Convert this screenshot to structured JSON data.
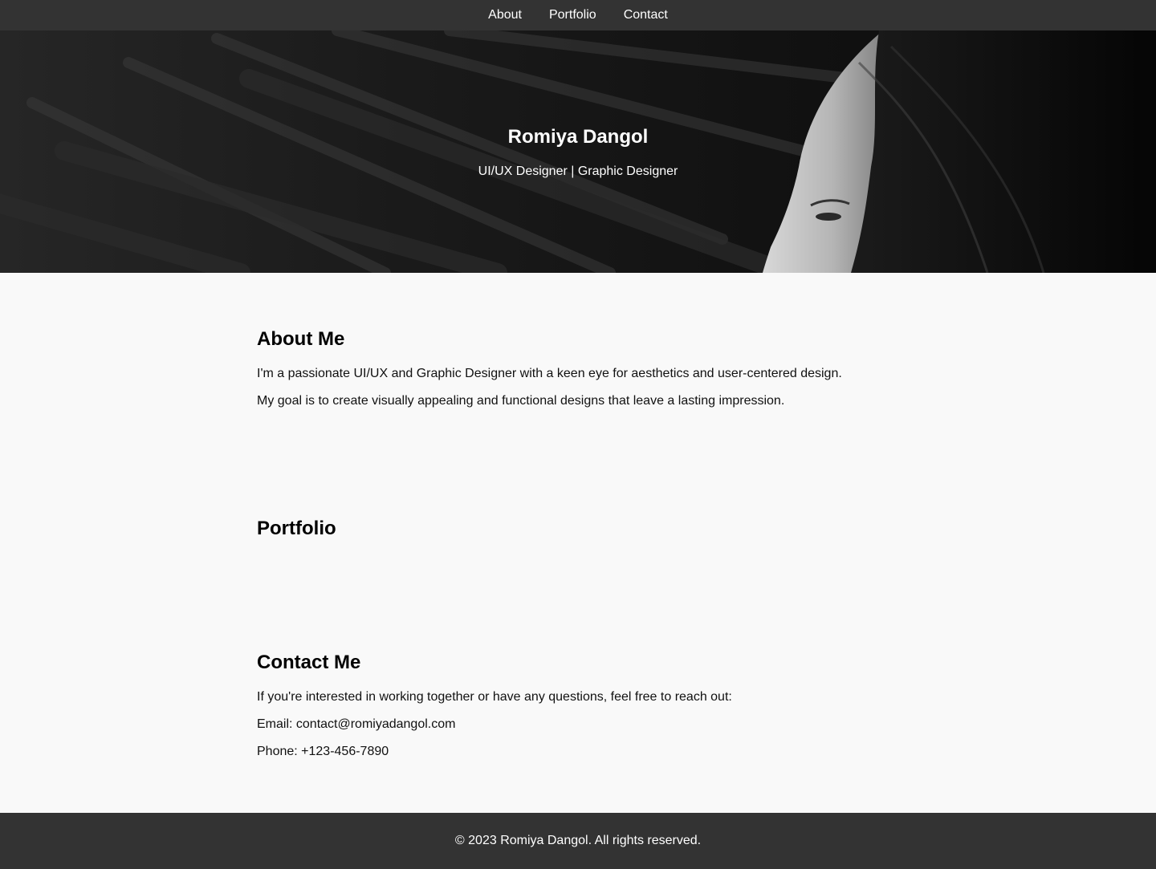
{
  "nav": {
    "links": [
      {
        "label": "About"
      },
      {
        "label": "Portfolio"
      },
      {
        "label": "Contact"
      }
    ]
  },
  "hero": {
    "title": "Romiya Dangol",
    "subtitle": "UI/UX Designer | Graphic Designer"
  },
  "about": {
    "heading": "About Me",
    "paragraphs": [
      "I'm a passionate UI/UX and Graphic Designer with a keen eye for aesthetics and user-centered design.",
      "My goal is to create visually appealing and functional designs that leave a lasting impression."
    ]
  },
  "portfolio": {
    "heading": "Portfolio"
  },
  "contact": {
    "heading": "Contact Me",
    "intro": "If you're interested in working together or have any questions, feel free to reach out:",
    "email": "Email: contact@romiyadangol.com",
    "phone": "Phone: +123-456-7890"
  },
  "footer": {
    "text": "© 2023 Romiya Dangol. All rights reserved."
  },
  "colors": {
    "nav_bg": "#333333",
    "page_bg": "#f9f9f9",
    "footer_bg": "#333333",
    "text": "#111111"
  }
}
